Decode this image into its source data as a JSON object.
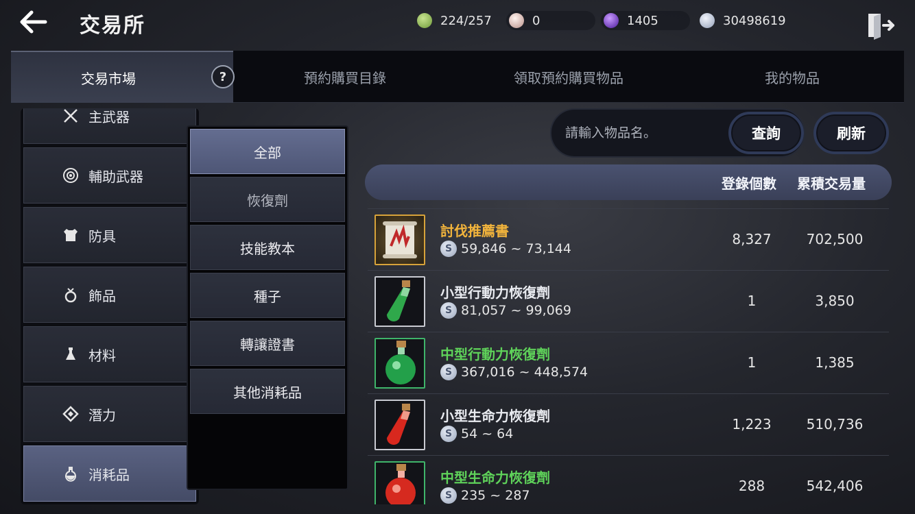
{
  "header": {
    "title": "交易所",
    "currencies": [
      {
        "icon": "green-stone-icon",
        "value": "224/257",
        "color": "#8bbf5a"
      },
      {
        "icon": "pearl-icon",
        "value": "0",
        "color": "#e3c9c4"
      },
      {
        "icon": "purple-orb-icon",
        "value": "1405",
        "color": "#7a3cd8"
      },
      {
        "icon": "silver-coin-icon",
        "value": "30498619",
        "color": "#c9d3e6"
      }
    ]
  },
  "tabs": [
    {
      "label": "交易市場",
      "active": true
    },
    {
      "label": "預約購買目錄"
    },
    {
      "label": "領取預約購買物品"
    },
    {
      "label": "我的物品"
    }
  ],
  "help_label": "?",
  "categories": [
    {
      "label": "主武器",
      "icon": "crossed-swords-icon"
    },
    {
      "label": "輔助武器",
      "icon": "target-icon"
    },
    {
      "label": "防具",
      "icon": "armor-icon"
    },
    {
      "label": "飾品",
      "icon": "ring-icon"
    },
    {
      "label": "材料",
      "icon": "flask-icon"
    },
    {
      "label": "潛力",
      "icon": "diamond-icon"
    },
    {
      "label": "消耗品",
      "icon": "potion-icon",
      "active": true
    }
  ],
  "subcategories": [
    {
      "label": "全部",
      "active": true
    },
    {
      "label": "恢復劑"
    },
    {
      "label": "技能教本"
    },
    {
      "label": "種子"
    },
    {
      "label": "轉讓證書"
    },
    {
      "label": "其他消耗品"
    }
  ],
  "search": {
    "placeholder": "請輸入物品名。",
    "query_label": "查詢",
    "refresh_label": "刷新"
  },
  "table": {
    "headers": {
      "count": "登錄個數",
      "volume": "累積交易量"
    },
    "rows": [
      {
        "name": "討伐推薦書",
        "price": "59,846 ~ 73,144",
        "count": "8,327",
        "volume": "702,500",
        "rarity": "gold",
        "icon": "scroll-icon"
      },
      {
        "name": "小型行動力恢復劑",
        "price": "81,057 ~ 99,069",
        "count": "1",
        "volume": "3,850",
        "rarity": "white",
        "icon": "green-potion-small-icon"
      },
      {
        "name": "中型行動力恢復劑",
        "price": "367,016 ~ 448,574",
        "count": "1",
        "volume": "1,385",
        "rarity": "green",
        "icon": "green-potion-medium-icon"
      },
      {
        "name": "小型生命力恢復劑",
        "price": "54 ~ 64",
        "count": "1,223",
        "volume": "510,736",
        "rarity": "white",
        "icon": "red-potion-small-icon"
      },
      {
        "name": "中型生命力恢復劑",
        "price": "235 ~ 287",
        "count": "288",
        "volume": "542,406",
        "rarity": "green",
        "icon": "red-potion-medium-icon"
      }
    ]
  },
  "coin_symbol": "S"
}
